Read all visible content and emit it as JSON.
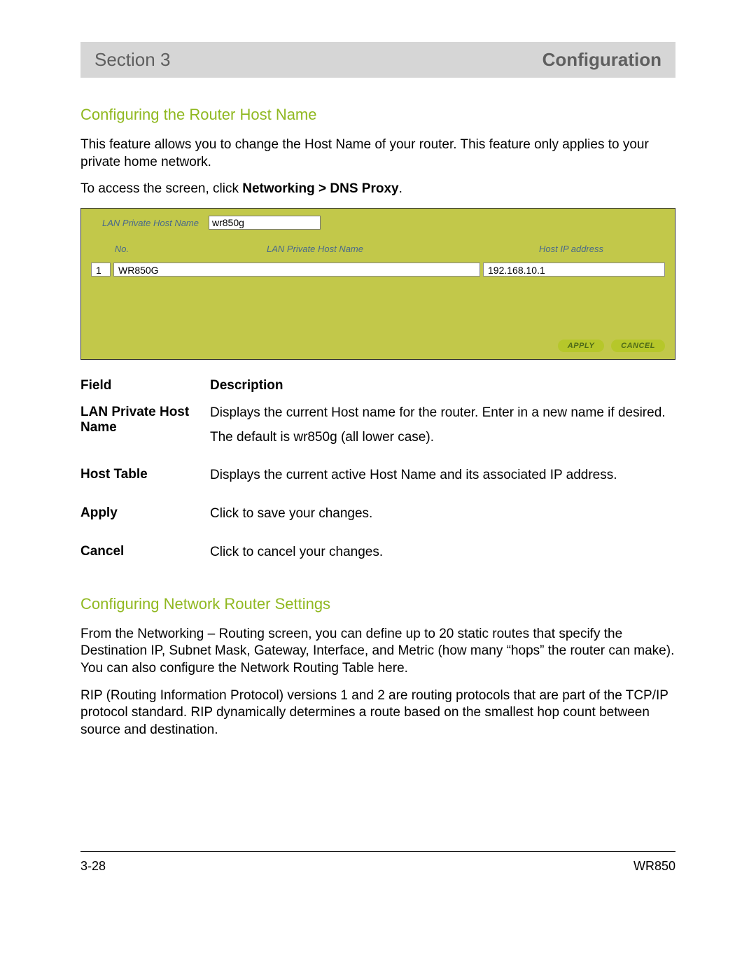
{
  "header": {
    "section_label": "Section 3",
    "page_title": "Configuration"
  },
  "sec1": {
    "title": "Configuring the Router Host Name",
    "intro": "This feature allows you to change the Host Name of your router. This feature only applies to your private home network.",
    "access_prefix": "To access the screen, click ",
    "access_path": "Networking > DNS Proxy",
    "access_suffix": "."
  },
  "panel": {
    "hostname_label": "LAN Private Host Name",
    "hostname_value": "wr850g",
    "col_no": "No.",
    "col_host": "LAN Private Host Name",
    "col_ip": "Host IP address",
    "rows": [
      {
        "no": "1",
        "host": "WR850G",
        "ip": "192.168.10.1"
      }
    ],
    "apply_btn": "APPLY",
    "cancel_btn": "CANCEL"
  },
  "fd": {
    "h_field": "Field",
    "h_desc": "Description",
    "items": [
      {
        "field": "LAN Private Host Name",
        "desc1": "Displays the current Host name for the router. Enter in a new name if desired.",
        "desc2": "The default is wr850g (all lower case)."
      },
      {
        "field": "Host Table",
        "desc1": "Displays the current active Host Name and its associated IP address.",
        "desc2": ""
      },
      {
        "field": "Apply",
        "desc1": "Click to save your changes.",
        "desc2": ""
      },
      {
        "field": "Cancel",
        "desc1": "Click to cancel your changes.",
        "desc2": ""
      }
    ]
  },
  "sec2": {
    "title": "Configuring Network Router Settings",
    "p1": "From the Networking – Routing screen, you can define up to 20 static routes that specify the Destination IP, Subnet Mask, Gateway, Interface, and Metric (how many “hops” the router can make). You can also configure the Network Routing Table here.",
    "p2": "RIP (Routing Information Protocol) versions 1 and 2 are routing protocols that are part of the TCP/IP protocol standard. RIP dynamically determines a route based on the smallest hop count between source and destination."
  },
  "footer": {
    "page_num": "3-28",
    "model": "WR850"
  }
}
